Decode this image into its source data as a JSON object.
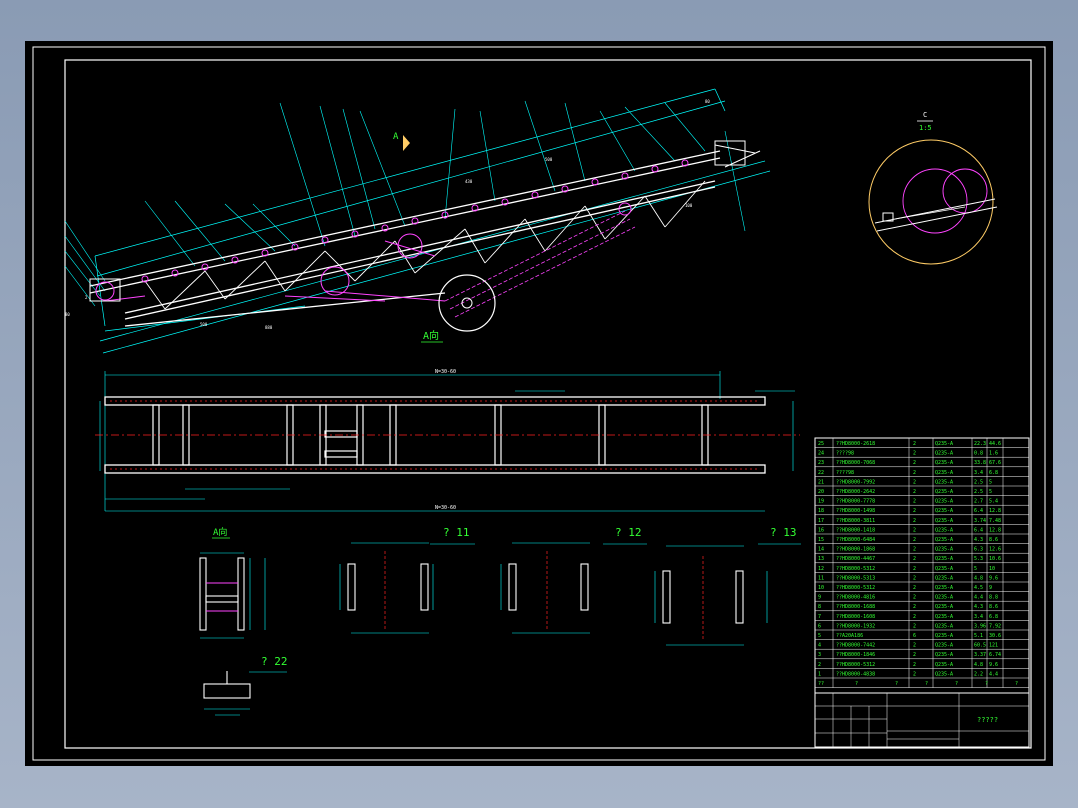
{
  "colors": {
    "background": "#000000",
    "border": "#ffffff",
    "dimension": "#00ffff",
    "structure": "#ffffff",
    "accent": "#ff44ff",
    "centerline": "#ff2222",
    "label_green": "#33ff33",
    "detail_circle": "#e0a0ff",
    "table_text": "#33ff33",
    "frame_bg": "#8a9bb4"
  },
  "labels": {
    "view_a_top": "A",
    "view_a_bottom": "A向",
    "detail_c": "C",
    "detail_scale": "1:5",
    "view_a_small": "A向",
    "section_11": "? 11",
    "section_12": "? 12",
    "section_13": "? 13",
    "section_22": "? 22",
    "title_name": "?????",
    "dim_long_top": "N=30-60",
    "dim_long_bottom": "N=30-60"
  },
  "parts_table": {
    "rows": [
      {
        "no": "25",
        "code": "??HD8000-2618",
        "qty": "2",
        "mat": "Q235-A",
        "w1": "22.3",
        "w2": "44.6"
      },
      {
        "no": "24",
        "code": "????98",
        "qty": "2",
        "mat": "Q235-A",
        "w1": "0.8",
        "w2": "1.6"
      },
      {
        "no": "23",
        "code": "??HD8000-7068",
        "qty": "2",
        "mat": "Q235-A",
        "w1": "33.8",
        "w2": "67.6"
      },
      {
        "no": "22",
        "code": "????98",
        "qty": "2",
        "mat": "Q235-A",
        "w1": "3.4",
        "w2": "6.8"
      },
      {
        "no": "21",
        "code": "??HD8000-7992",
        "qty": "2",
        "mat": "Q235-A",
        "w1": "2.5",
        "w2": "5"
      },
      {
        "no": "20",
        "code": "??HD8000-2642",
        "qty": "2",
        "mat": "Q235-A",
        "w1": "2.5",
        "w2": "5"
      },
      {
        "no": "19",
        "code": "??HD8000-7778",
        "qty": "2",
        "mat": "Q235-A",
        "w1": "2.7",
        "w2": "5.4"
      },
      {
        "no": "18",
        "code": "??HD8000-1498",
        "qty": "2",
        "mat": "Q235-A",
        "w1": "6.4",
        "w2": "12.8"
      },
      {
        "no": "17",
        "code": "??HD8000-3811",
        "qty": "2",
        "mat": "Q235-A",
        "w1": "3.74",
        "w2": "7.48"
      },
      {
        "no": "16",
        "code": "??HD8000-1418",
        "qty": "2",
        "mat": "Q235-A",
        "w1": "6.4",
        "w2": "12.8"
      },
      {
        "no": "15",
        "code": "??HD8000-6484",
        "qty": "2",
        "mat": "Q235-A",
        "w1": "4.3",
        "w2": "8.6"
      },
      {
        "no": "14",
        "code": "??HD8000-1868",
        "qty": "2",
        "mat": "Q235-A",
        "w1": "6.3",
        "w2": "12.6"
      },
      {
        "no": "13",
        "code": "??HD8000-4467",
        "qty": "2",
        "mat": "Q235-A",
        "w1": "5.3",
        "w2": "10.6"
      },
      {
        "no": "12",
        "code": "??HD8000-5312",
        "qty": "2",
        "mat": "Q235-A",
        "w1": "5",
        "w2": "10"
      },
      {
        "no": "11",
        "code": "??HD8000-5313",
        "qty": "2",
        "mat": "Q235-A",
        "w1": "4.8",
        "w2": "9.6"
      },
      {
        "no": "10",
        "code": "??HD8000-5312",
        "qty": "2",
        "mat": "Q235-A",
        "w1": "4.5",
        "w2": "9"
      },
      {
        "no": "9",
        "code": "??HD8000-4816",
        "qty": "2",
        "mat": "Q235-A",
        "w1": "4.4",
        "w2": "8.8"
      },
      {
        "no": "8",
        "code": "??HD8000-1688",
        "qty": "2",
        "mat": "Q235-A",
        "w1": "4.3",
        "w2": "8.6"
      },
      {
        "no": "7",
        "code": "??HD8000-1608",
        "qty": "2",
        "mat": "Q235-A",
        "w1": "3.4",
        "w2": "6.8"
      },
      {
        "no": "6",
        "code": "??HD8000-1932",
        "qty": "2",
        "mat": "Q235-A",
        "w1": "3.96",
        "w2": "7.92"
      },
      {
        "no": "5",
        "code": "??A20A186",
        "qty": "6",
        "mat": "Q235-A",
        "w1": "5.1",
        "w2": "30.6"
      },
      {
        "no": "4",
        "code": "??HD8000-7442",
        "qty": "2",
        "mat": "Q235-A",
        "w1": "60.5",
        "w2": "121"
      },
      {
        "no": "3",
        "code": "??HD8000-1846",
        "qty": "2",
        "mat": "Q235-A",
        "w1": "3.37",
        "w2": "6.74"
      },
      {
        "no": "2",
        "code": "??HD8000-5312",
        "qty": "2",
        "mat": "Q235-A",
        "w1": "4.8",
        "w2": "9.6"
      },
      {
        "no": "1",
        "code": "??HD8000-4838",
        "qty": "2",
        "mat": "Q235-A",
        "w1": "2.2",
        "w2": "4.4"
      }
    ],
    "header": [
      "??",
      "?",
      "?",
      "?",
      "?",
      "?",
      "?"
    ]
  }
}
